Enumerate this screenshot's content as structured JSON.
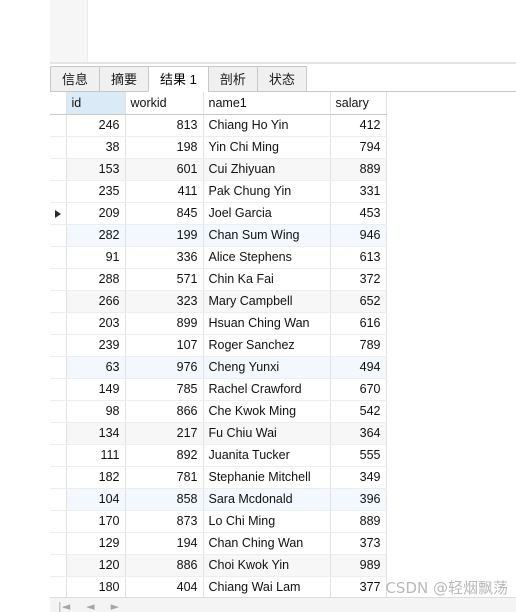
{
  "tabs": [
    {
      "label": "信息",
      "active": false
    },
    {
      "label": "摘要",
      "active": false
    },
    {
      "label": "结果 1",
      "active": true
    },
    {
      "label": "剖析",
      "active": false
    },
    {
      "label": "状态",
      "active": false
    }
  ],
  "grid": {
    "columns": [
      {
        "key": "id",
        "label": "id",
        "align": "right",
        "selected": true
      },
      {
        "key": "workid",
        "label": "workid",
        "align": "right",
        "selected": false
      },
      {
        "key": "name1",
        "label": "name1",
        "align": "left",
        "selected": false
      },
      {
        "key": "salary",
        "label": "salary",
        "align": "right",
        "selected": false
      }
    ],
    "current_row_index": 4,
    "rows": [
      {
        "id": "246",
        "workid": "813",
        "name1": "Chiang Ho Yin",
        "salary": "412"
      },
      {
        "id": "38",
        "workid": "198",
        "name1": "Yin Chi Ming",
        "salary": "794"
      },
      {
        "id": "153",
        "workid": "601",
        "name1": "Cui Zhiyuan",
        "salary": "889"
      },
      {
        "id": "235",
        "workid": "411",
        "name1": "Pak Chung Yin",
        "salary": "331"
      },
      {
        "id": "209",
        "workid": "845",
        "name1": "Joel Garcia",
        "salary": "453"
      },
      {
        "id": "282",
        "workid": "199",
        "name1": "Chan Sum Wing",
        "salary": "946"
      },
      {
        "id": "91",
        "workid": "336",
        "name1": "Alice Stephens",
        "salary": "613"
      },
      {
        "id": "288",
        "workid": "571",
        "name1": "Chin Ka Fai",
        "salary": "372"
      },
      {
        "id": "266",
        "workid": "323",
        "name1": "Mary Campbell",
        "salary": "652"
      },
      {
        "id": "203",
        "workid": "899",
        "name1": "Hsuan Ching Wan",
        "salary": "616"
      },
      {
        "id": "239",
        "workid": "107",
        "name1": "Roger Sanchez",
        "salary": "789"
      },
      {
        "id": "63",
        "workid": "976",
        "name1": "Cheng Yunxi",
        "salary": "494"
      },
      {
        "id": "149",
        "workid": "785",
        "name1": "Rachel Crawford",
        "salary": "670"
      },
      {
        "id": "98",
        "workid": "866",
        "name1": "Che Kwok Ming",
        "salary": "542"
      },
      {
        "id": "134",
        "workid": "217",
        "name1": "Fu Chiu Wai",
        "salary": "364"
      },
      {
        "id": "111",
        "workid": "892",
        "name1": "Juanita Tucker",
        "salary": "555"
      },
      {
        "id": "182",
        "workid": "781",
        "name1": "Stephanie Mitchell",
        "salary": "349"
      },
      {
        "id": "104",
        "workid": "858",
        "name1": "Sara Mcdonald",
        "salary": "396"
      },
      {
        "id": "170",
        "workid": "873",
        "name1": "Lo Chi Ming",
        "salary": "889"
      },
      {
        "id": "129",
        "workid": "194",
        "name1": "Chan Ching Wan",
        "salary": "373"
      },
      {
        "id": "120",
        "workid": "886",
        "name1": "Choi Kwok Yin",
        "salary": "989"
      },
      {
        "id": "180",
        "workid": "404",
        "name1": "Chiang Wai Lam",
        "salary": "377"
      }
    ]
  },
  "navbar": {
    "icons": [
      {
        "name": "first-record-icon",
        "glyph": "|◄"
      },
      {
        "name": "previous-record-icon",
        "glyph": "◄"
      },
      {
        "name": "next-record-icon",
        "glyph": "►"
      }
    ]
  },
  "watermark": {
    "text": "CSDN @轻烟飘荡"
  },
  "colors": {
    "selected_header": "#dbeaf7",
    "alt_row": "#f7f7f7",
    "blue_row": "#f2f8fd",
    "grid_line": "#e2e2e2",
    "tab_inactive": "#f0f0f0",
    "tab_border": "#c8c8c8",
    "watermark": "#b9b9b9"
  }
}
